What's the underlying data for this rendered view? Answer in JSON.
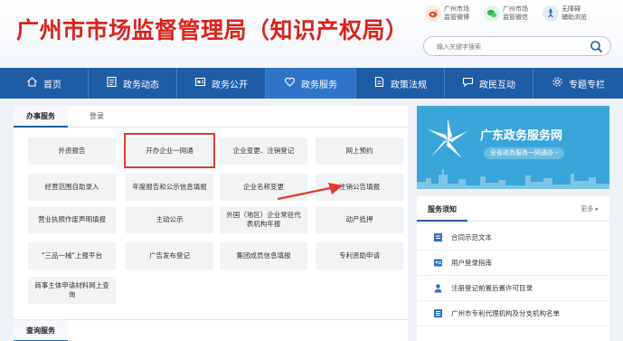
{
  "header": {
    "title": "广州市市场监督管理局（知识产权局）",
    "top_links": [
      {
        "icon": "weibo-icon",
        "line1": "广州市场",
        "line2": "监管微博"
      },
      {
        "icon": "wechat-icon",
        "line1": "广州市场",
        "line2": "监管微信"
      },
      {
        "icon": "accessibility-icon",
        "line1": "无障碍",
        "line2": "辅助浏览"
      }
    ],
    "search_placeholder": "输入关键字搜索"
  },
  "nav": [
    {
      "label": "首页",
      "icon": "home-icon"
    },
    {
      "label": "政务动态",
      "icon": "news-icon"
    },
    {
      "label": "政务公开",
      "icon": "open-gov-icon"
    },
    {
      "label": "政务服务",
      "icon": "heart-icon"
    },
    {
      "label": "政策法规",
      "icon": "document-icon"
    },
    {
      "label": "政民互动",
      "icon": "chat-icon"
    },
    {
      "label": "专题专栏",
      "icon": "gear-icon"
    }
  ],
  "main": {
    "tabs": [
      "办事服务",
      "登录"
    ],
    "services": [
      "外资报告",
      "开办企业一网通",
      "企业变更、注销登记",
      "网上预约",
      "经营范围自助录入",
      "年度报告和公示信息填报",
      "企业名称变更",
      "注销公告填报",
      "营业执照作废声明填报",
      "主动公示",
      "外国（地区）企业常驻代表机构年报",
      "动产抵押",
      "\"三品一械\"上报平台",
      "广告发布登记",
      "集团成员信息填报",
      "专利资助申请",
      "商事主体申请材料网上查询"
    ],
    "query_tab": "查询服务"
  },
  "banner": {
    "title": "广东政务服务网",
    "subtitle": "全省政务服务一网通办 ›"
  },
  "notice": {
    "title": "服务须知",
    "more": "更多 ▸",
    "items": [
      {
        "label": "合同示范文本",
        "icon": "contract-icon"
      },
      {
        "label": "用户登录指南",
        "icon": "login-guide-icon"
      },
      {
        "label": "注册登记前置后置许可目录",
        "icon": "user-icon"
      },
      {
        "label": "广州市专利代理机构及分支机构名单",
        "icon": "list-icon"
      }
    ]
  },
  "colors": {
    "title_red": "#d9231c",
    "nav_blue": "#1f5ca6",
    "banner_blue": "#3aa5d8",
    "highlight_red": "#e13b2f"
  }
}
